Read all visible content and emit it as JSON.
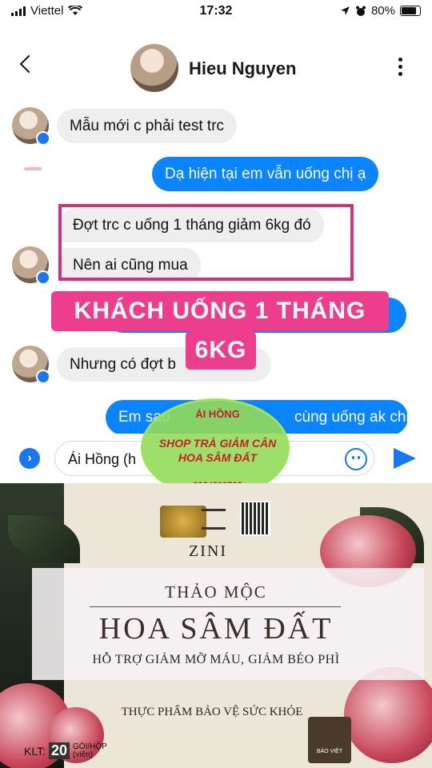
{
  "status_bar": {
    "carrier": "Viettel",
    "time": "17:32",
    "battery": "80%",
    "battery_fraction": 0.8
  },
  "header": {
    "contact_name": "Hieu Nguyen"
  },
  "messages": [
    {
      "side": "in",
      "text": "Mẫu mới c phải test trc"
    },
    {
      "side": "out",
      "text": "Dạ hiện tại em vẫn uống chị ạ"
    },
    {
      "side": "in",
      "text": "Đợt trc c uống 1 tháng giảm 6kg đó"
    },
    {
      "side": "in",
      "text": "Nên ai cũng mua"
    },
    {
      "side": "in",
      "text": "Nhưng có đợt b"
    },
    {
      "side": "out",
      "text": "Em sau"
    },
    {
      "side": "out",
      "text": "cùng uống ak chị"
    }
  ],
  "overlay": {
    "line1": "KHÁCH UỐNG 1 THÁNG GIẢM",
    "line2": "6KG",
    "color": "#ed3d8d"
  },
  "composer": {
    "draft": "Ái Hồng (h"
  },
  "watermark": {
    "top": "ÁI HỒNG",
    "line1": "SHOP TRÀ GIẢM CÂN",
    "line2": "HOA SÂM ĐẤT",
    "phone": "0964880763"
  },
  "product": {
    "brand": "ZINI",
    "subtitle": "THẢO MỘC",
    "title": "HOA SÂM ĐẤT",
    "tagline": "HỖ TRỢ GIẢM MỠ MÁU, GIẢM BÉO PHÌ",
    "category": "THỰC PHẨM BẢO VỆ SỨC KHỎE",
    "klt_label": "KLT:",
    "count": "20",
    "unit": "GÓI/HỘP",
    "unit_note": "(viên)",
    "badge": "BẢO VIỆT"
  },
  "colors": {
    "outgoing_bubble": "#0b84ff",
    "incoming_bubble": "#eeeeef",
    "messenger_blue": "#1778f2",
    "highlight_border": "#d4317a"
  }
}
